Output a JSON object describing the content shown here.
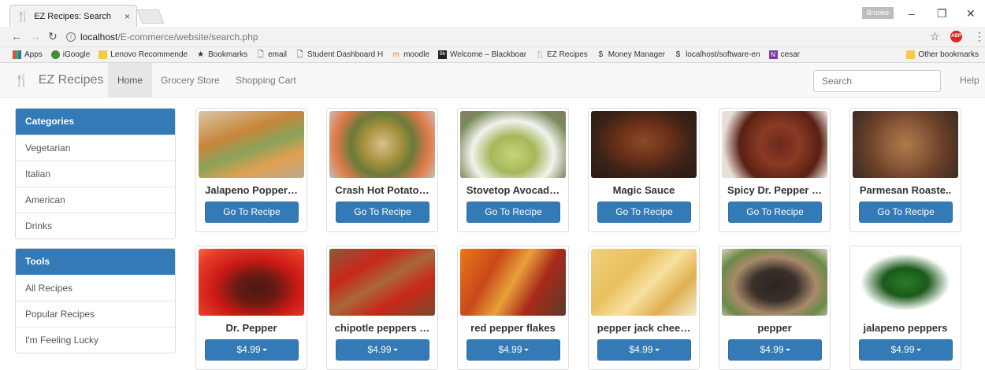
{
  "browser": {
    "tab_title": "EZ Recipes: Search",
    "tab_close": "×",
    "user_name": "Brooke",
    "url_host": "localhost",
    "url_path": "/E-commerce/website/search.php",
    "bookmarks": [
      {
        "label": "Apps",
        "icon": "apps-icon"
      },
      {
        "label": "iGoogle",
        "icon": "igoogle-icon"
      },
      {
        "label": "Lenovo Recommende",
        "icon": "folder-icon"
      },
      {
        "label": "Bookmarks",
        "icon": "star-icon"
      },
      {
        "label": "email",
        "icon": "page-icon"
      },
      {
        "label": "Student Dashboard H",
        "icon": "page-icon"
      },
      {
        "label": "moodle",
        "icon": "moodle-icon"
      },
      {
        "label": "Welcome – Blackboar",
        "icon": "blackboard-icon"
      },
      {
        "label": "EZ Recipes",
        "icon": "fork-knife-icon"
      },
      {
        "label": "Money Manager",
        "icon": "dollar-icon"
      },
      {
        "label": "localhost/software-en",
        "icon": "dollar-icon"
      },
      {
        "label": "cesar",
        "icon": "onenote-icon"
      }
    ],
    "other_bookmarks": "Other bookmarks"
  },
  "site": {
    "brand": "EZ Recipes",
    "nav": [
      "Home",
      "Grocery Store",
      "Shopping Cart"
    ],
    "search_placeholder": "Search",
    "help": "Help"
  },
  "sidebar": {
    "categories_title": "Categories",
    "categories": [
      "Vegetarian",
      "Italian",
      "American",
      "Drinks"
    ],
    "tools_title": "Tools",
    "tools": [
      "All Recipes",
      "Popular Recipes",
      "I'm Feeling Lucky"
    ]
  },
  "recipes": {
    "button_label": "Go To Recipe",
    "items": [
      {
        "name": "Jalapeno Popper…",
        "image": "grilled-sandwich"
      },
      {
        "name": "Crash Hot Potato…",
        "image": "crash-potatoes"
      },
      {
        "name": "Stovetop Avocad…",
        "image": "avocado-pasta"
      },
      {
        "name": "Magic Sauce",
        "image": "sauce-pan"
      },
      {
        "name": "Spicy Dr. Pepper …",
        "image": "pulled-pork"
      },
      {
        "name": "Parmesan Roaste..",
        "image": "roasted-potatoes"
      }
    ]
  },
  "groceries": {
    "items": [
      {
        "name": "Dr. Pepper",
        "price": "$4.99",
        "image": "soda-glass"
      },
      {
        "name": "chipotle peppers …",
        "price": "$4.99",
        "image": "chili-peppers"
      },
      {
        "name": "red pepper flakes",
        "price": "$4.99",
        "image": "spice-piles"
      },
      {
        "name": "pepper jack chee…",
        "price": "$4.99",
        "image": "cheese"
      },
      {
        "name": "pepper",
        "price": "$4.99",
        "image": "peppercorns"
      },
      {
        "name": "jalapeno peppers",
        "price": "$4.99",
        "image": "jalapenos"
      }
    ]
  }
}
